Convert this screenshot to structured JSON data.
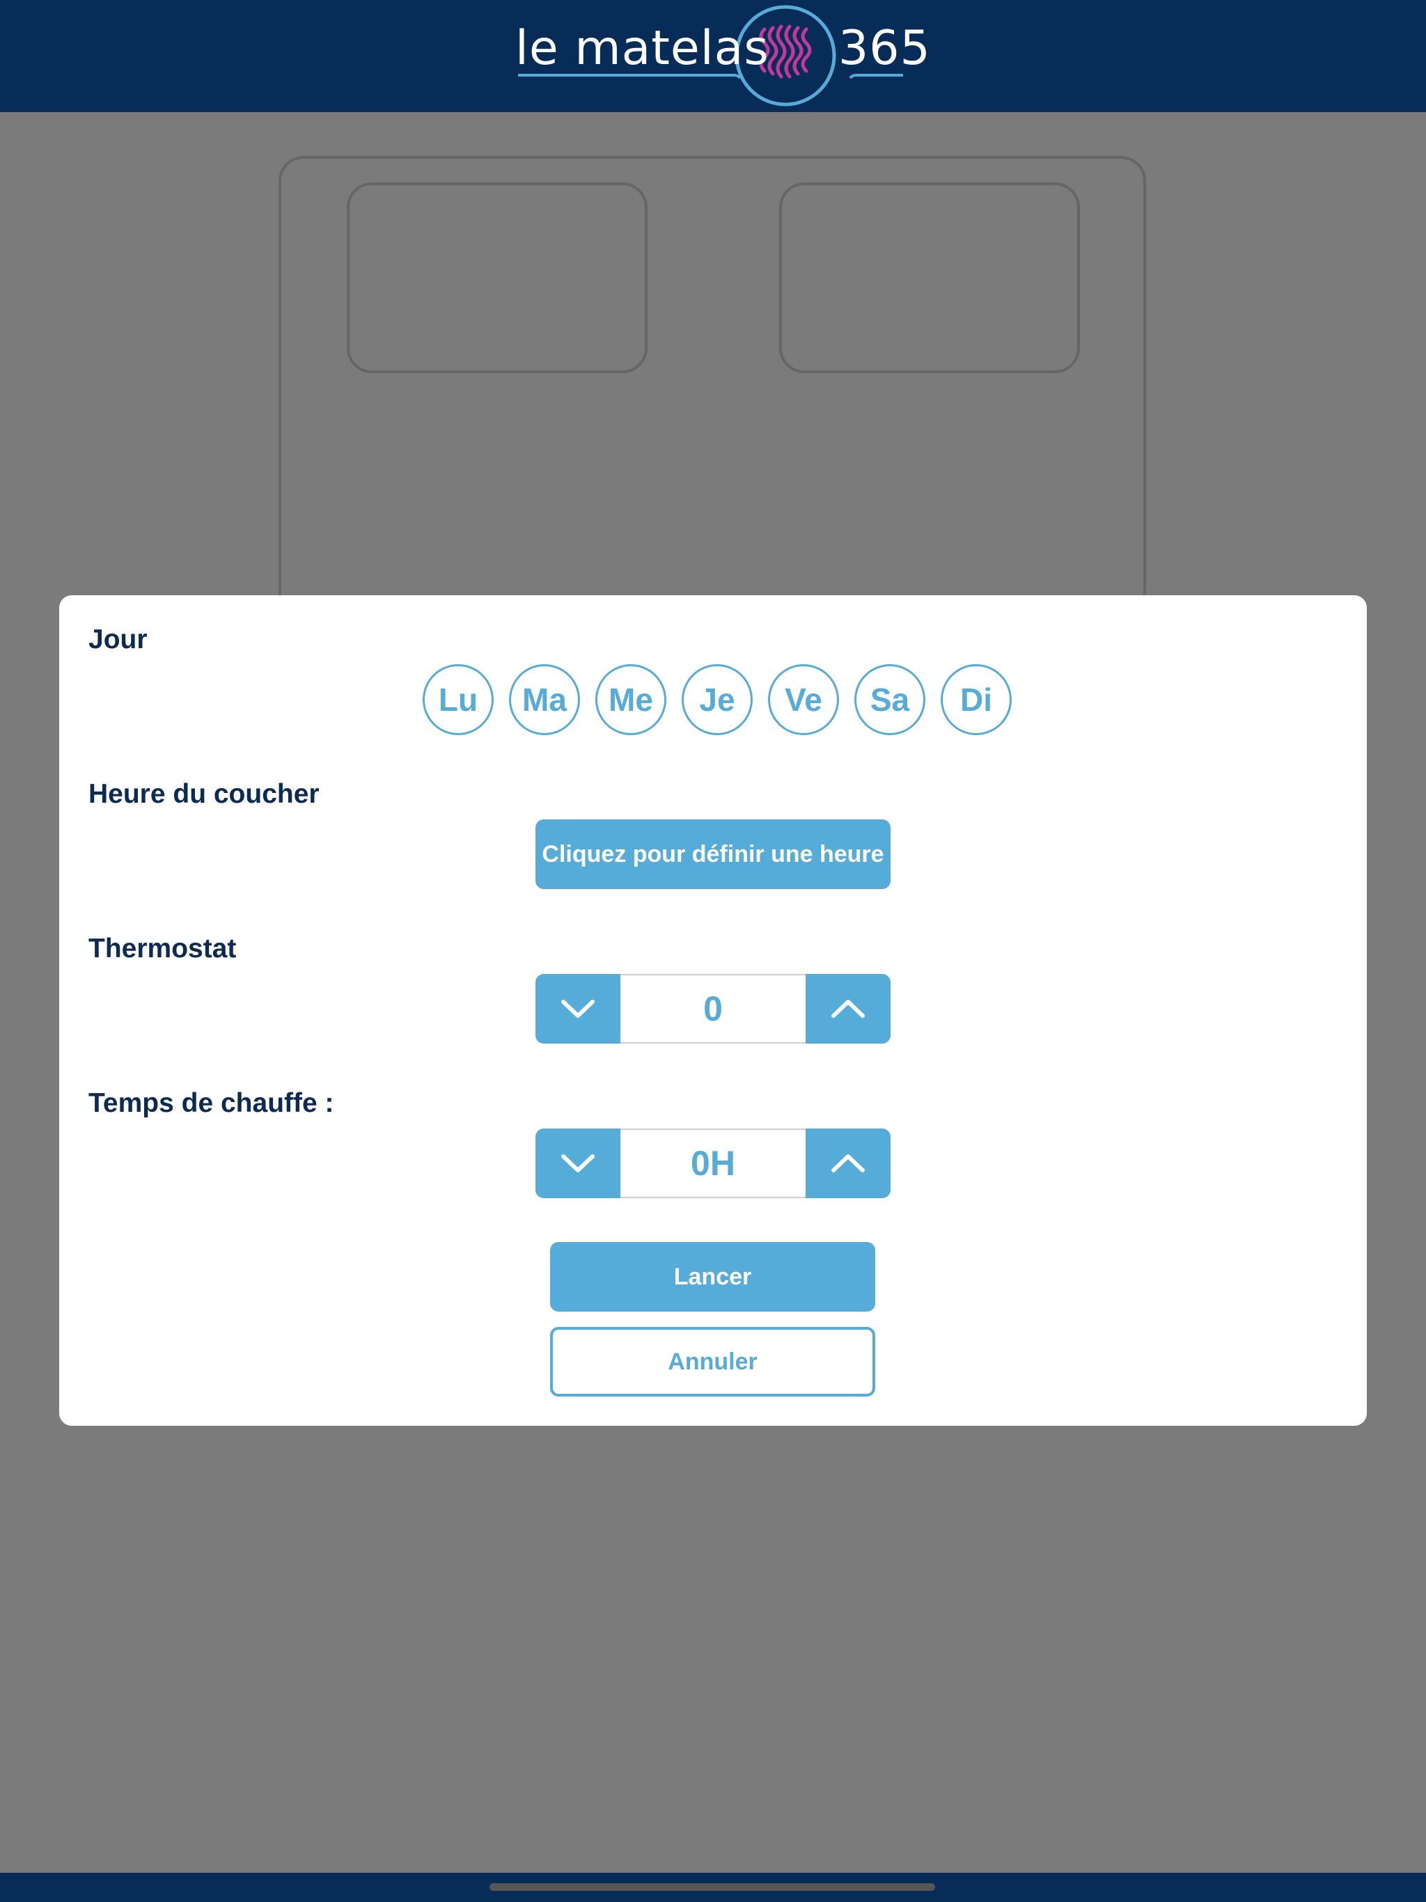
{
  "header": {
    "logo_text_left": "le matelas",
    "logo_text_right": "365"
  },
  "colors": {
    "navy": "#072c58",
    "accent": "#56acd9",
    "label": "#0d2b52",
    "overlay": "#7b7b7b",
    "logo_waves": "#c2399a"
  },
  "modal": {
    "day_section_label": "Jour",
    "days": [
      {
        "label": "Lu"
      },
      {
        "label": "Ma"
      },
      {
        "label": "Me"
      },
      {
        "label": "Je"
      },
      {
        "label": "Ve"
      },
      {
        "label": "Sa"
      },
      {
        "label": "Di"
      }
    ],
    "bedtime_label": "Heure du coucher",
    "bedtime_button": "Cliquez pour définir une heure",
    "thermostat_label": "Thermostat",
    "thermostat_value": "0",
    "heating_label": "Temps de chauffe :",
    "heating_value": "0H",
    "launch_button": "Lancer",
    "cancel_button": "Annuler"
  },
  "icons": {
    "decrement": "chevron-down-icon",
    "increment": "chevron-up-icon",
    "logo": "heating-waves-icon"
  }
}
